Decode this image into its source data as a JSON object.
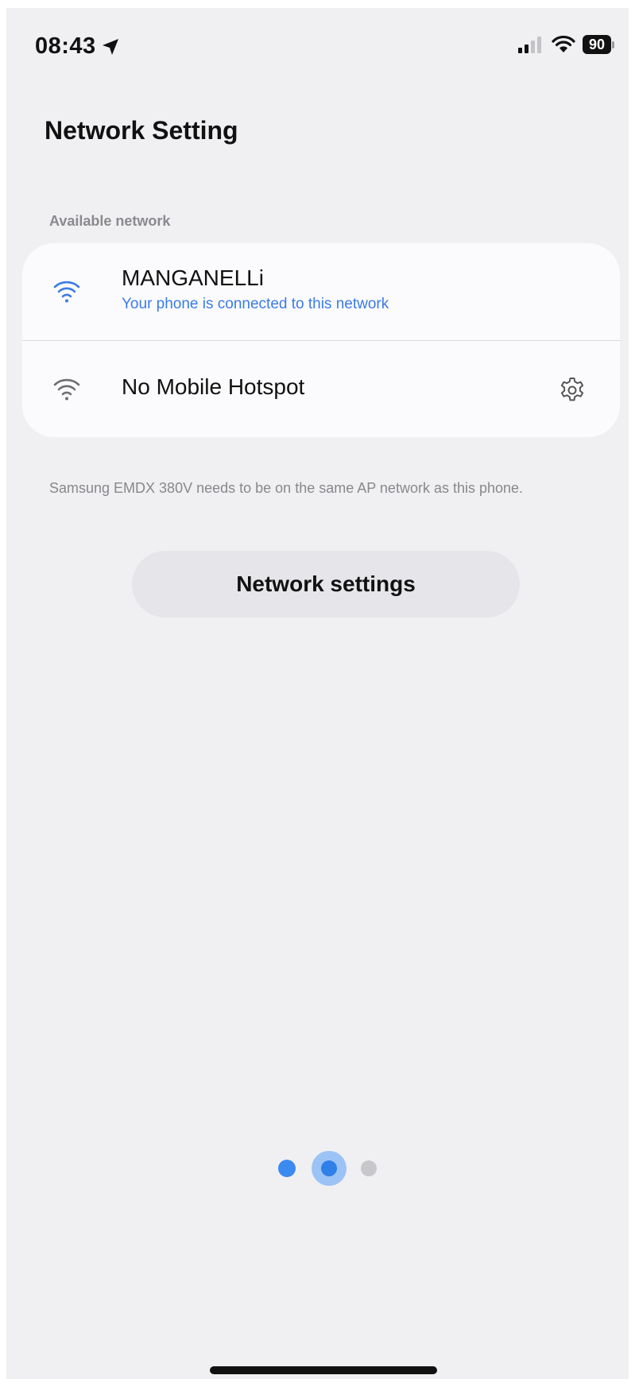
{
  "status_bar": {
    "time": "08:43",
    "battery": "90"
  },
  "page": {
    "title": "Network Setting"
  },
  "networks": {
    "section_label": "Available network",
    "items": [
      {
        "name": "MANGANELLi",
        "status": "Your phone is connected to this network",
        "icon": "wifi-icon",
        "connected": true,
        "icon_color": "#3b7be8"
      },
      {
        "name": "No Mobile Hotspot",
        "status": "",
        "icon": "wifi-icon",
        "connected": false,
        "icon_color": "#6e6e73"
      }
    ]
  },
  "note": "Samsung EMDX 380V needs to be on the same AP network as this phone.",
  "actions": {
    "network_settings_label": "Network settings"
  },
  "pager": {
    "total": 3,
    "current": 2
  },
  "colors": {
    "accent": "#3b7be8",
    "background": "#f0f0f3",
    "card": "#fbfbfd"
  }
}
